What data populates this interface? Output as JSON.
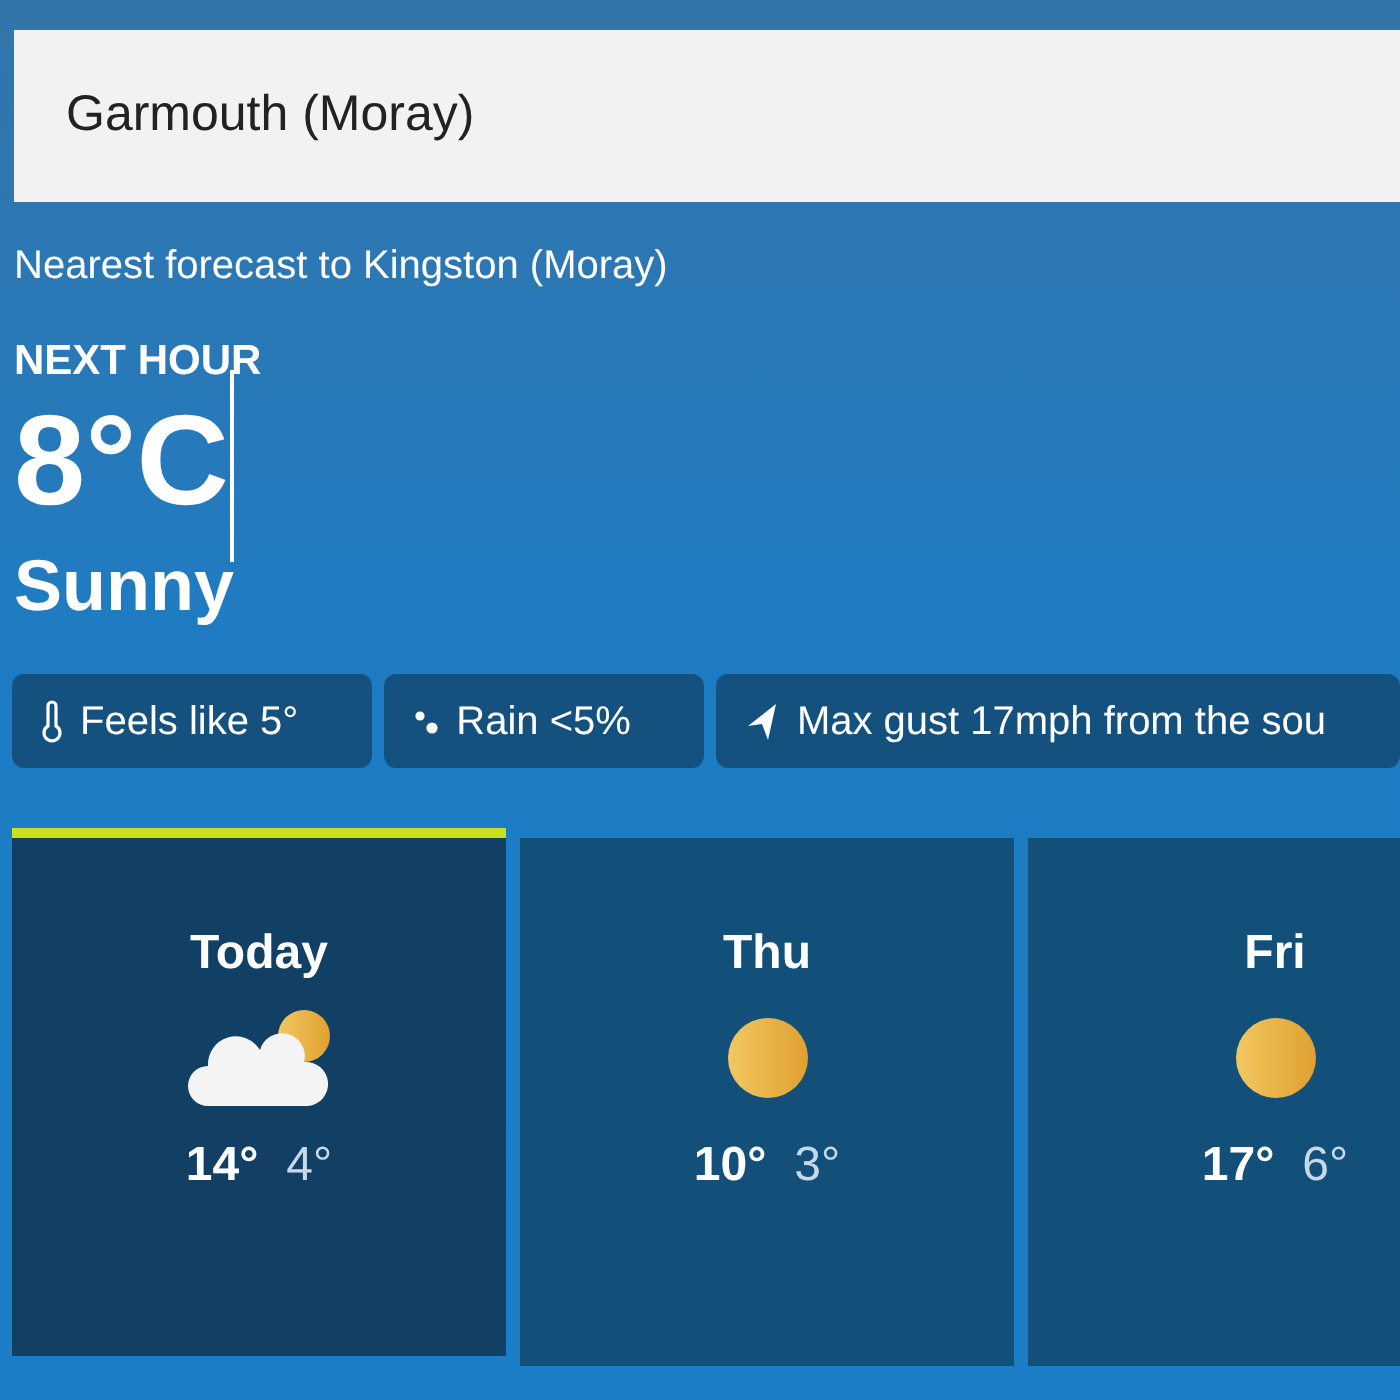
{
  "search": {
    "value": "Garmouth (Moray)"
  },
  "nearest": "Nearest forecast to Kingston (Moray)",
  "next_hour": {
    "label": "NEXT HOUR",
    "temperature": "8°C",
    "condition": "Sunny"
  },
  "chips": [
    {
      "kind": "feels",
      "text": "Feels like 5°"
    },
    {
      "kind": "rain",
      "text": "Rain <5%"
    },
    {
      "kind": "gust",
      "text": "Max gust 17mph from the sou"
    }
  ],
  "days": [
    {
      "name": "Today",
      "selected": true,
      "kind": "partly-cloudy",
      "high": "14°",
      "low": "4°"
    },
    {
      "name": "Thu",
      "selected": false,
      "kind": "sunny",
      "high": "10°",
      "low": "3°"
    },
    {
      "name": "Fri",
      "selected": false,
      "kind": "sunny",
      "high": "17°",
      "low": "6°"
    }
  ]
}
